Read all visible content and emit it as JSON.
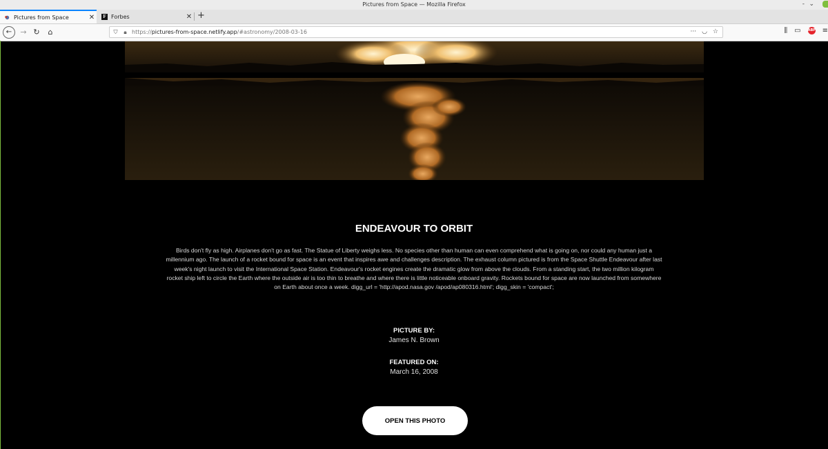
{
  "window": {
    "title": "Pictures from Space — Mozilla Firefox",
    "controls": [
      "-",
      "⌄",
      "⨯"
    ]
  },
  "tabs": [
    {
      "label": "Pictures from Space",
      "active": true,
      "icon": "satellite-icon"
    },
    {
      "label": "Forbes",
      "active": false,
      "icon": "forbes-f-icon"
    }
  ],
  "new_tab_label": "+",
  "url": {
    "prefix": "https://",
    "host": "pictures-from-space.netlify.app",
    "path": "/#astronomy/2008-03-16"
  },
  "url_right_icons": [
    "···",
    "⬡",
    "☆"
  ],
  "article": {
    "title": "ENDEAVOUR TO ORBIT",
    "description": "Birds don't fly as high. Airplanes don't go as fast. The Statue of Liberty weighs less. No species other than human can even comprehend what is going on, nor could any human just a millennium ago. The launch of a rocket bound for space is an event that inspires awe and challenges description. The exhaust column pictured is from the Space Shuttle Endeavour after last week's night launch to visit the International Space Station. Endeavour's rocket engines create the dramatic glow from above the clouds. From a standing start, the two million kilogram rocket ship left to circle the Earth where the outside air is too thin to breathe and where there is little noticeable onboard gravity. Rockets bound for space are now launched from somewhere on Earth about once a week. digg_url = 'http://apod.nasa.gov /apod/ap080316.html'; digg_skin = 'compact';",
    "picture_by_label": "PICTURE BY:",
    "picture_by": "James N. Brown",
    "featured_on_label": "FEATURED ON:",
    "featured_on": "March 16, 2008",
    "open_button": "OPEN THIS PHOTO"
  },
  "colors": {
    "page_bg": "#000000",
    "accent_tab": "#0a84ff",
    "plume": "#e0a050"
  }
}
